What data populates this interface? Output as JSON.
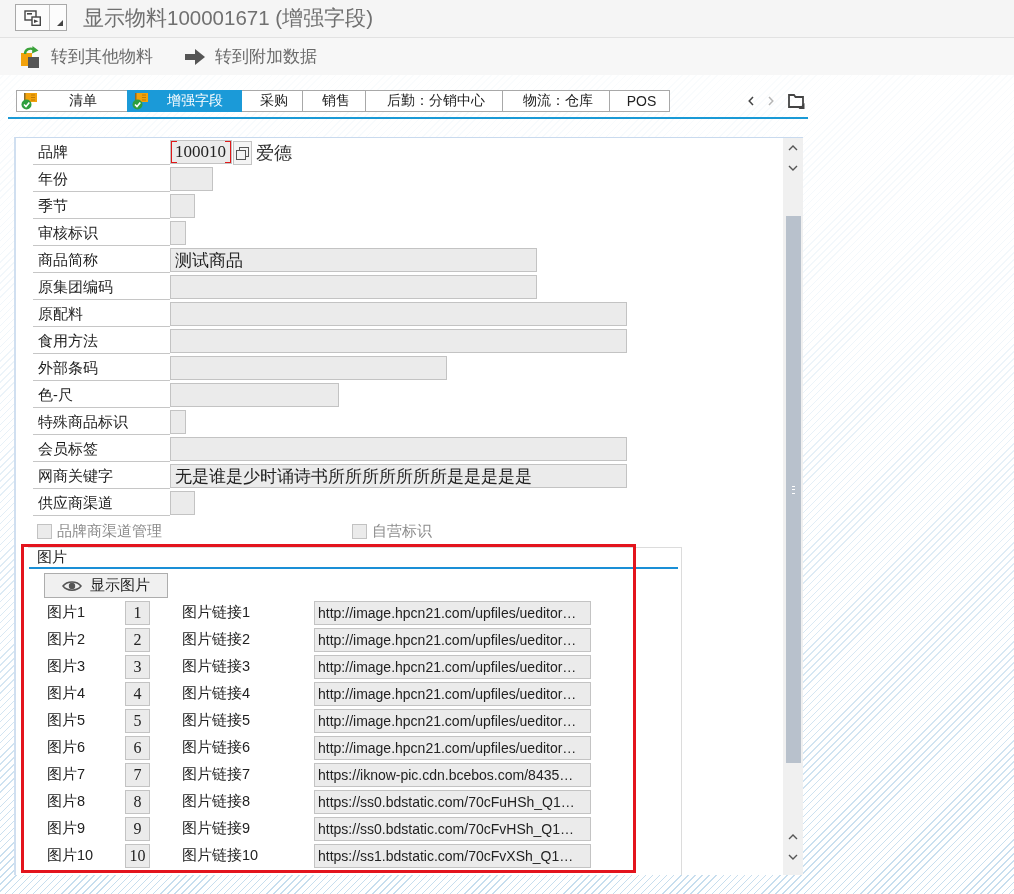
{
  "window": {
    "title": "显示物料100001671 (增强字段)"
  },
  "toolbar": [
    {
      "kind": "switch",
      "label": "转到其他物料"
    },
    {
      "kind": "forward",
      "label": "转到附加数据"
    }
  ],
  "tabs": [
    {
      "kind": "status",
      "label": "清单",
      "selected": false
    },
    {
      "kind": "status",
      "label": "增强字段",
      "selected": true
    },
    {
      "kind": "plain",
      "label": "采购",
      "selected": false
    },
    {
      "kind": "plain",
      "label": "销售",
      "selected": false
    },
    {
      "kind": "plain",
      "label": "后勤：分销中心",
      "selected": false
    },
    {
      "kind": "plain",
      "label": "物流：仓库",
      "selected": false
    },
    {
      "kind": "plain",
      "label": "POS",
      "selected": false
    }
  ],
  "form": {
    "fields": [
      {
        "label": "品牌",
        "value": "100010",
        "focused": true,
        "value_help": true,
        "description": "爱德"
      },
      {
        "label": "年份",
        "focused": false,
        "value_help": false
      },
      {
        "label": "季节",
        "focused": false,
        "value_help": false
      },
      {
        "label": "审核标识",
        "focused": false,
        "value_help": false
      },
      {
        "label": "商品简称",
        "value": "测试商品",
        "focused": false,
        "value_help": false
      },
      {
        "label": "原集团编码",
        "focused": false,
        "value_help": false
      },
      {
        "label": "原配料",
        "focused": false,
        "value_help": false
      },
      {
        "label": "食用方法",
        "focused": false,
        "value_help": false
      },
      {
        "label": "外部条码",
        "focused": false,
        "value_help": false
      },
      {
        "label": "色-尺",
        "focused": false,
        "value_help": false
      },
      {
        "label": "特殊商品标识",
        "focused": false,
        "value_help": false
      },
      {
        "label": "会员标签",
        "focused": false,
        "value_help": false
      },
      {
        "label": "网商关键字",
        "value": "无是谁是少时诵诗书所所所所所所所是是是是是",
        "focused": false,
        "value_help": false
      },
      {
        "label": "供应商渠道",
        "focused": false,
        "value_help": false
      }
    ]
  },
  "checkboxes": [
    {
      "label": "品牌商渠道管理",
      "checked": false,
      "disabled": true
    },
    {
      "label": "自营标识",
      "checked": false,
      "disabled": true
    }
  ],
  "pictures": {
    "title": "图片",
    "highlighted": true,
    "button": "显示图片",
    "rows": [
      {
        "label": "图片1",
        "number": "1",
        "link_label": "图片链接1",
        "link": "http://image.hpcn21.com/upfiles/ueditor…"
      },
      {
        "label": "图片2",
        "number": "2",
        "link_label": "图片链接2",
        "link": "http://image.hpcn21.com/upfiles/ueditor…"
      },
      {
        "label": "图片3",
        "number": "3",
        "link_label": "图片链接3",
        "link": "http://image.hpcn21.com/upfiles/ueditor…"
      },
      {
        "label": "图片4",
        "number": "4",
        "link_label": "图片链接4",
        "link": "http://image.hpcn21.com/upfiles/ueditor…"
      },
      {
        "label": "图片5",
        "number": "5",
        "link_label": "图片链接5",
        "link": "http://image.hpcn21.com/upfiles/ueditor…"
      },
      {
        "label": "图片6",
        "number": "6",
        "link_label": "图片链接6",
        "link": "http://image.hpcn21.com/upfiles/ueditor…"
      },
      {
        "label": "图片7",
        "number": "7",
        "link_label": "图片链接7",
        "link": "https://iknow-pic.cdn.bcebos.com/8435…"
      },
      {
        "label": "图片8",
        "number": "8",
        "link_label": "图片链接8",
        "link": "https://ss0.bdstatic.com/70cFuHSh_Q1…"
      },
      {
        "label": "图片9",
        "number": "9",
        "link_label": "图片链接9",
        "link": "https://ss0.bdstatic.com/70cFvHSh_Q1…"
      },
      {
        "label": "图片10",
        "number": "10",
        "link_label": "图片链接10",
        "link": "https://ss1.bdstatic.com/70cFvXSh_Q1…"
      }
    ]
  }
}
